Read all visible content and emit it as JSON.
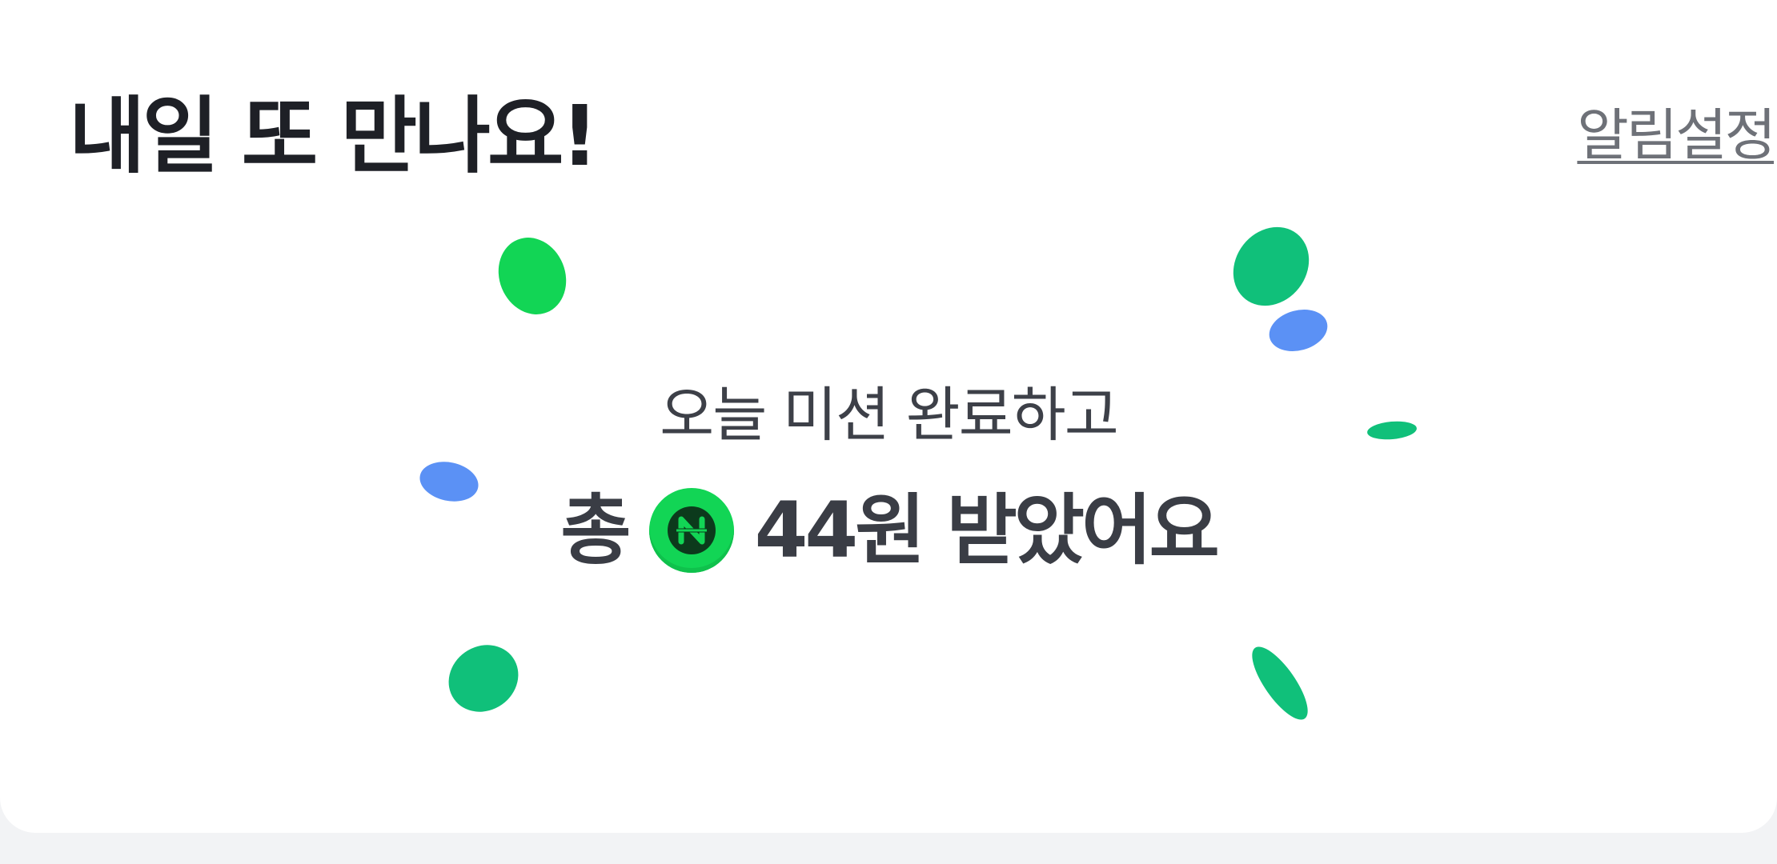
{
  "header": {
    "title": "내일 또 만나요!",
    "alarm_link": "알림설정"
  },
  "reward": {
    "subtitle": "오늘 미션 완료하고",
    "prefix": "총",
    "coin_icon": "naver-pay-coin-icon",
    "amount": "44원",
    "suffix": "받았어요"
  },
  "colors": {
    "green": "#12d555",
    "teal": "#10c07a",
    "blue": "#5b91f5",
    "coin": "#12d555"
  }
}
